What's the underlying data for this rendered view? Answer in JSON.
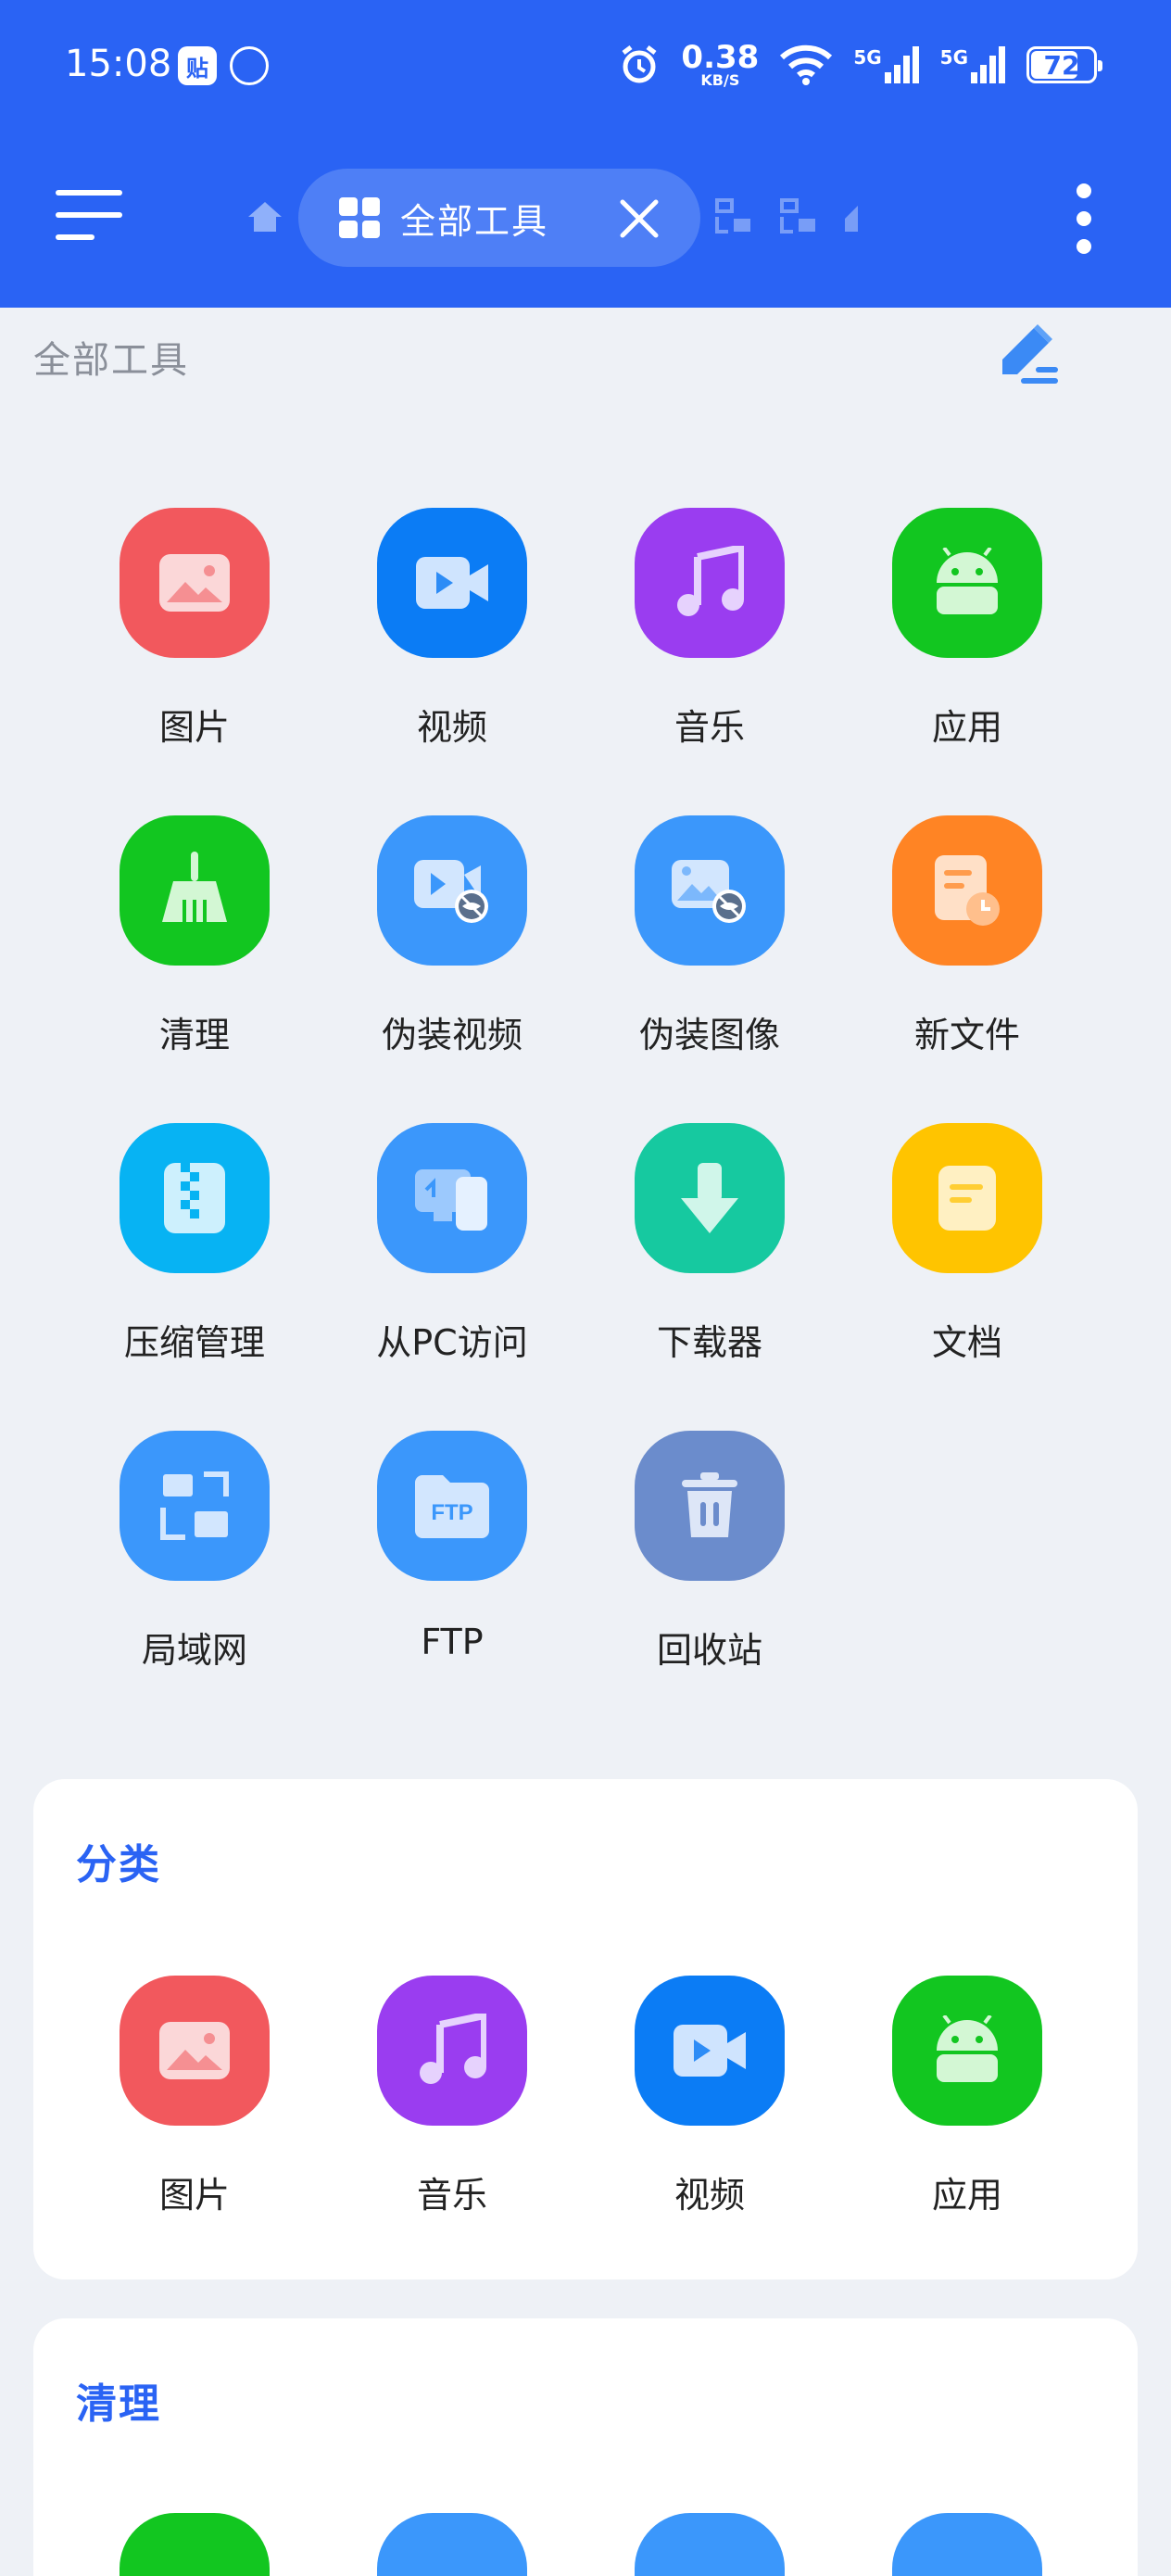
{
  "status_bar": {
    "time": "15:08",
    "badge": "贴",
    "speed_value": "0.38",
    "speed_unit": "KB/S",
    "signal1": "5G",
    "signal2": "5G",
    "battery": "72"
  },
  "header": {
    "active_tab_label": "全部工具"
  },
  "page_title": "全部工具",
  "tools": [
    {
      "label": "图片",
      "icon": "image-icon",
      "color": "#f2585d"
    },
    {
      "label": "视频",
      "icon": "video-icon",
      "color": "#0b7cf5"
    },
    {
      "label": "音乐",
      "icon": "music-icon",
      "color": "#9a3df0"
    },
    {
      "label": "应用",
      "icon": "android-icon",
      "color": "#12c620"
    },
    {
      "label": "清理",
      "icon": "broom-icon",
      "color": "#12c620"
    },
    {
      "label": "伪装视频",
      "icon": "hidden-video-icon",
      "color": "#3b97fb"
    },
    {
      "label": "伪装图像",
      "icon": "hidden-image-icon",
      "color": "#3b97fb"
    },
    {
      "label": "新文件",
      "icon": "recent-file-icon",
      "color": "#ff8424"
    },
    {
      "label": "压缩管理",
      "icon": "zip-icon",
      "color": "#07b3f3"
    },
    {
      "label": "从PC访问",
      "icon": "pc-access-icon",
      "color": "#3b97fb"
    },
    {
      "label": "下载器",
      "icon": "download-icon",
      "color": "#16c9a0"
    },
    {
      "label": "文档",
      "icon": "document-icon",
      "color": "#ffc400"
    },
    {
      "label": "局域网",
      "icon": "lan-icon",
      "color": "#3b97fb"
    },
    {
      "label": "FTP",
      "icon": "ftp-icon",
      "color": "#3b97fb"
    },
    {
      "label": "回收站",
      "icon": "trash-icon",
      "color": "#6b8ccc"
    }
  ],
  "categories_card": {
    "title": "分类",
    "items": [
      {
        "label": "图片",
        "icon": "image-icon",
        "color": "#f2585d"
      },
      {
        "label": "音乐",
        "icon": "music-icon",
        "color": "#9a3df0"
      },
      {
        "label": "视频",
        "icon": "video-icon",
        "color": "#0b7cf5"
      },
      {
        "label": "应用",
        "icon": "android-icon",
        "color": "#12c620"
      }
    ]
  },
  "clean_card": {
    "title": "清理"
  }
}
